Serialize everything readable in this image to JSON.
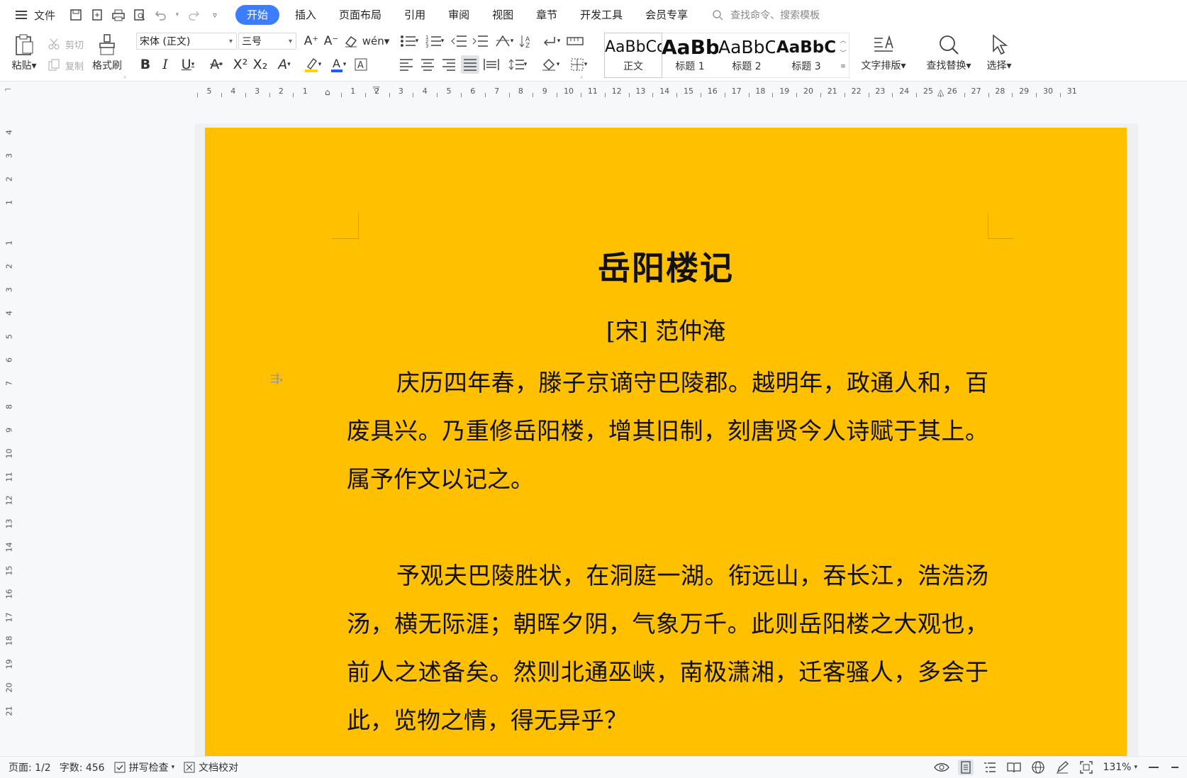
{
  "menubar": {
    "file_label": "文件",
    "tabs": [
      {
        "label": "开始",
        "active": true
      },
      {
        "label": "插入"
      },
      {
        "label": "页面布局"
      },
      {
        "label": "引用"
      },
      {
        "label": "审阅"
      },
      {
        "label": "视图"
      },
      {
        "label": "章节"
      },
      {
        "label": "开发工具"
      },
      {
        "label": "会员专享"
      }
    ],
    "search_placeholder": "查找命令、搜索模板"
  },
  "toolbar": {
    "paste_label": "粘贴",
    "cut_label": "剪切",
    "copy_label": "复制",
    "format_painter_label": "格式刷",
    "font_name": "宋体 (正文)",
    "font_size": "三号",
    "styles": [
      {
        "preview": "AaBbCc",
        "name": "正文"
      },
      {
        "preview": "AaBb",
        "name": "标题 1"
      },
      {
        "preview": "AaBbC",
        "name": "标题 2"
      },
      {
        "preview": "AaBbC",
        "name": "标题 3"
      }
    ],
    "text_layout_label": "文字排版",
    "find_replace_label": "查找替换",
    "select_label": "选择"
  },
  "ruler": {
    "left_numbers": [
      "5",
      "4",
      "3",
      "2",
      "1"
    ],
    "right_numbers": [
      "1",
      "2",
      "3",
      "4",
      "5",
      "6",
      "7",
      "8",
      "9",
      "10",
      "11",
      "12",
      "13",
      "14",
      "15",
      "16",
      "17",
      "18",
      "19",
      "20",
      "21",
      "22",
      "23",
      "24",
      "25",
      "26",
      "27",
      "28",
      "29",
      "30",
      "31"
    ],
    "vertical_numbers": [
      "4",
      "3",
      "2",
      "1",
      "1",
      "2",
      "3",
      "4",
      "5",
      "6",
      "7",
      "8",
      "9",
      "10",
      "11",
      "12",
      "13",
      "14",
      "15",
      "16",
      "17",
      "18",
      "19",
      "20",
      "21"
    ]
  },
  "document": {
    "title": "岳阳楼记",
    "author": "[宋]  范仲淹",
    "paragraphs": [
      "庆历四年春，滕子京谪守巴陵郡。越明年，政通人和，百废具兴。乃重修岳阳楼，增其旧制，刻唐贤今人诗赋于其上。属予作文以记之。",
      "予观夫巴陵胜状，在洞庭一湖。衔远山，吞长江，浩浩汤汤，横无际涯；朝晖夕阴，气象万千。此则岳阳楼之大观也，前人之述备矣。然则北通巫峡，南极潇湘，迁客骚人，多会于此，览物之情，得无异乎？"
    ],
    "page_color": "#ffc000"
  },
  "status": {
    "page": "页面: 1/2",
    "word_count": "字数: 456",
    "spell_check": "拼写检查",
    "doc_proof": "文档校对",
    "zoom": "131%"
  },
  "colors": {
    "accent": "#3c7dff",
    "font_color_bar": "#1f5cff",
    "highlight_bar": "#ffd400"
  }
}
